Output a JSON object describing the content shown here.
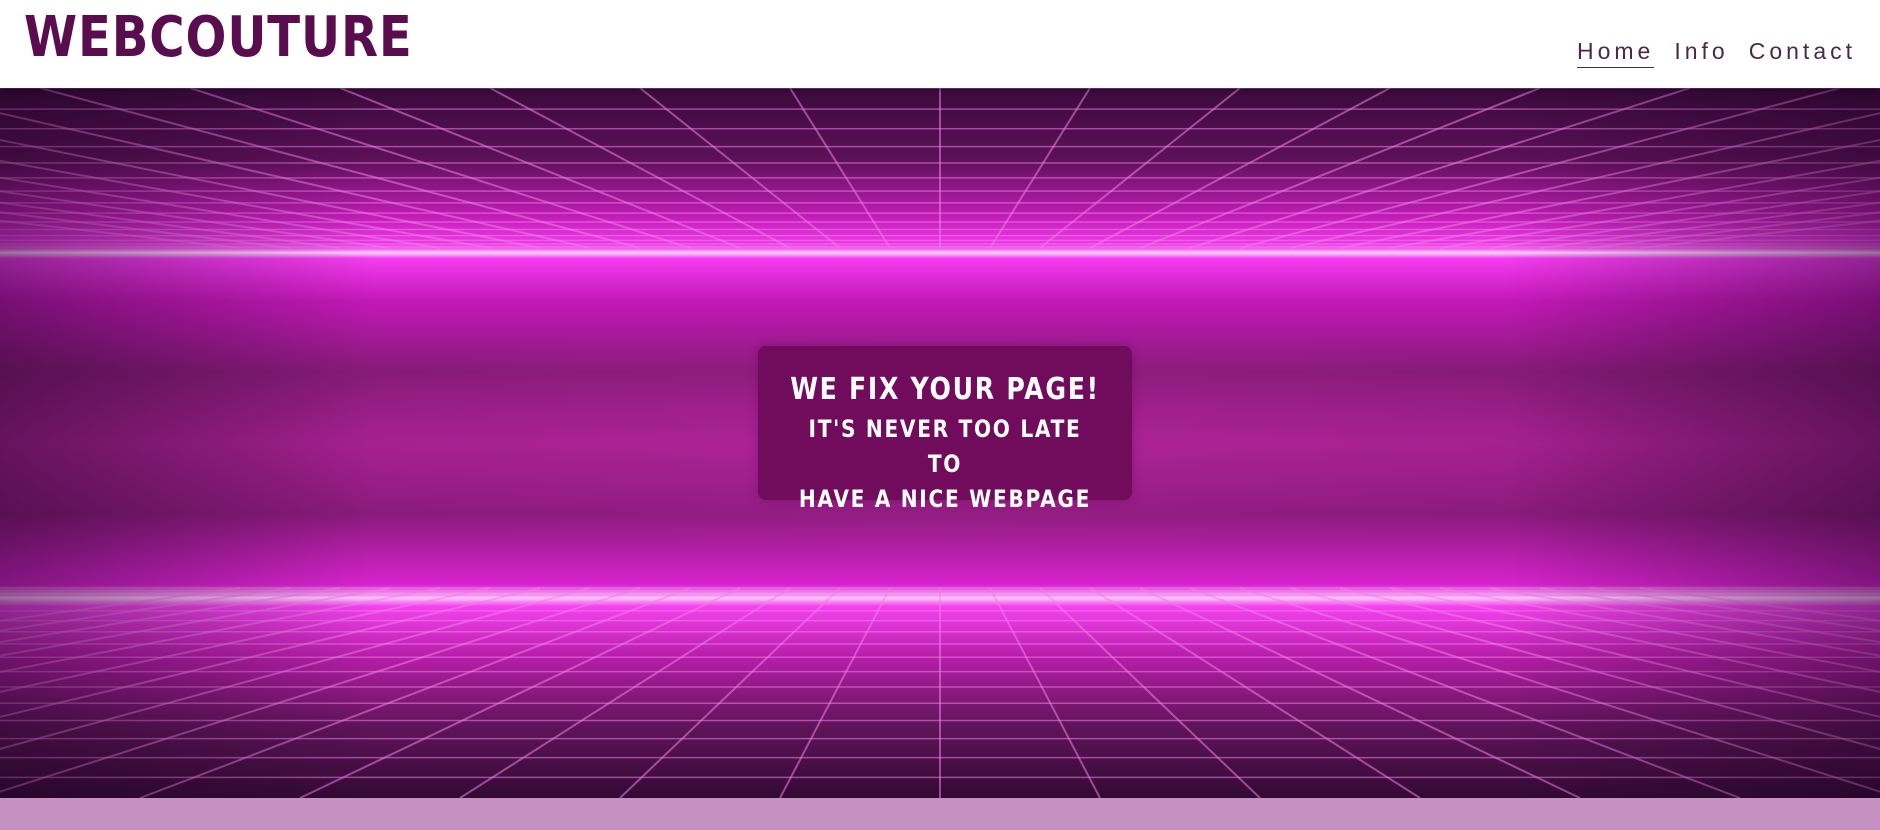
{
  "header": {
    "logo_text": "WEBCOUTURE",
    "nav": [
      {
        "label": "Home",
        "active": true
      },
      {
        "label": "Info",
        "active": false
      },
      {
        "label": "Contact",
        "active": false
      }
    ]
  },
  "hero": {
    "title": "WE FIX YOUR PAGE!",
    "subtitle_line1": "IT'S NEVER TOO LATE TO",
    "subtitle_line2": "HAVE A NICE WEBPAGE"
  },
  "colors": {
    "brand": "#5a0d4e",
    "callout_bg": "#710b5c",
    "neon": "#ff2bff",
    "footer_strip": "#c591c2"
  }
}
